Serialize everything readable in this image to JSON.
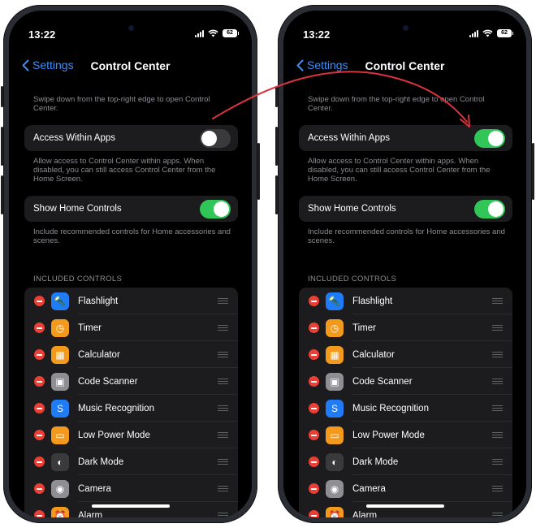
{
  "status": {
    "time": "13:22",
    "battery": "62"
  },
  "nav": {
    "back_label": "Settings",
    "title": "Control Center"
  },
  "description": "Swipe down from the top-right edge to open Control Center.",
  "access_within_apps": {
    "label": "Access Within Apps",
    "footer": "Allow access to Control Center within apps. When disabled, you can still access Control Center from the Home Screen."
  },
  "home_controls": {
    "label": "Show Home Controls",
    "footer": "Include recommended controls for Home accessories and scenes."
  },
  "included_controls_header": "INCLUDED CONTROLS",
  "controls": [
    {
      "label": "Flashlight",
      "icon": "flashlight-icon",
      "color": "#1f7cf6",
      "glyph": "🔦"
    },
    {
      "label": "Timer",
      "icon": "timer-icon",
      "color": "#f39a1d",
      "glyph": "◷"
    },
    {
      "label": "Calculator",
      "icon": "calculator-icon",
      "color": "#f39a1d",
      "glyph": "▦"
    },
    {
      "label": "Code Scanner",
      "icon": "qr-code-icon",
      "color": "#8e8e93",
      "glyph": "▣"
    },
    {
      "label": "Music Recognition",
      "icon": "shazam-icon",
      "color": "#1f7cf6",
      "glyph": "S"
    },
    {
      "label": "Low Power Mode",
      "icon": "battery-icon",
      "color": "#f39a1d",
      "glyph": "▭"
    },
    {
      "label": "Dark Mode",
      "icon": "dark-mode-icon",
      "color": "#3a3a3c",
      "glyph": "◐"
    },
    {
      "label": "Camera",
      "icon": "camera-icon",
      "color": "#8e8e93",
      "glyph": "◉"
    },
    {
      "label": "Alarm",
      "icon": "alarm-icon",
      "color": "#f39a1d",
      "glyph": "⏰"
    }
  ],
  "phones": [
    {
      "side": "left",
      "access_within_apps_on": false,
      "home_controls_on": true
    },
    {
      "side": "right",
      "access_within_apps_on": true,
      "home_controls_on": true
    }
  ],
  "colors": {
    "accent_blue": "#3e8ef7",
    "toggle_on": "#30c758",
    "toggle_off": "#3a3a3c",
    "remove_red": "#ea3f35",
    "arrow_red": "#d9333f"
  }
}
